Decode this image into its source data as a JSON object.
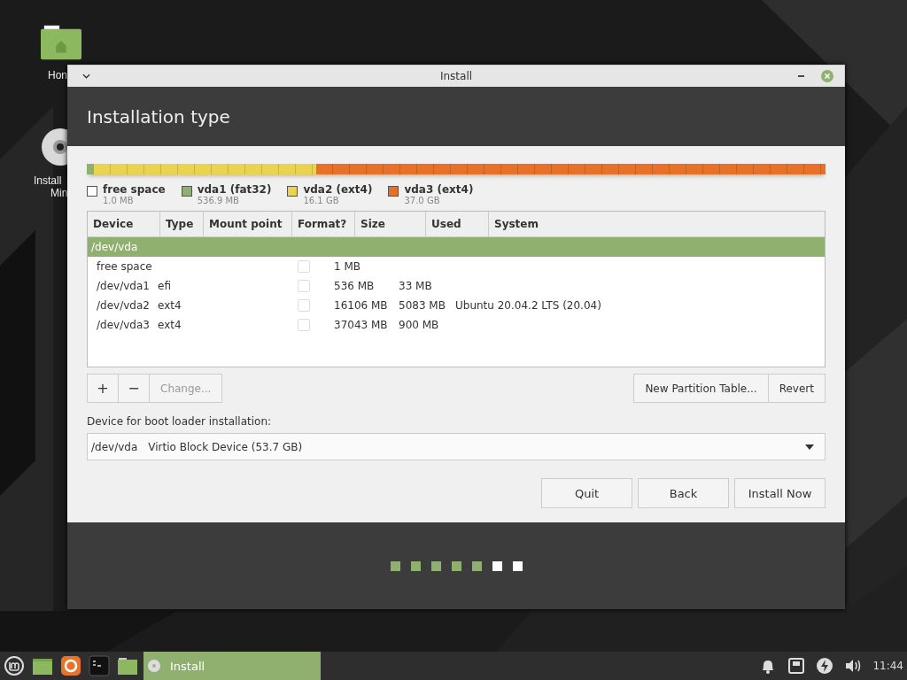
{
  "desktop_icons": [
    {
      "label": "Hon",
      "kind": "folder"
    },
    {
      "label": "Install",
      "label_2": "Min",
      "kind": "disc"
    }
  ],
  "window": {
    "title": "Install",
    "heading": "Installation type"
  },
  "partition_bar": [
    {
      "name": "free space",
      "size": "1.0 MB",
      "color": "#ffffff"
    },
    {
      "name": "vda1 (fat32)",
      "size": "536.9 MB",
      "color": "#8fb06f"
    },
    {
      "name": "vda2 (ext4)",
      "size": "16.1 GB",
      "color": "#e9d34f"
    },
    {
      "name": "vda3 (ext4)",
      "size": "37.0 GB",
      "color": "#e8712a"
    }
  ],
  "table": {
    "columns": [
      "Device",
      "Type",
      "Mount point",
      "Format?",
      "Size",
      "Used",
      "System"
    ],
    "rows": [
      {
        "kind": "disk",
        "device": "/dev/vda",
        "selected": true
      },
      {
        "kind": "partition",
        "device": "free space",
        "type": "",
        "mount": "",
        "format": false,
        "size": "1 MB",
        "used": "",
        "system": "",
        "selected": false
      },
      {
        "kind": "partition",
        "device": "/dev/vda1",
        "type": "efi",
        "mount": "",
        "format": false,
        "size": "536 MB",
        "used": "33 MB",
        "system": "",
        "selected": false
      },
      {
        "kind": "partition",
        "device": "/dev/vda2",
        "type": "ext4",
        "mount": "",
        "format": false,
        "size": "16106 MB",
        "used": "5083 MB",
        "system": "Ubuntu 20.04.2 LTS (20.04)",
        "selected": false
      },
      {
        "kind": "partition",
        "device": "/dev/vda3",
        "type": "ext4",
        "mount": "",
        "format": false,
        "size": "37043 MB",
        "used": "900 MB",
        "system": "",
        "selected": false
      }
    ]
  },
  "table_buttons": {
    "add": "+",
    "remove": "−",
    "change": "Change...",
    "new_table": "New Partition Table...",
    "revert": "Revert"
  },
  "boot_loader": {
    "label": "Device for boot loader installation:",
    "device": "/dev/vda",
    "description": "Virtio Block Device (53.7 GB)"
  },
  "buttons": [
    "Quit",
    "Back",
    "Install Now"
  ],
  "progress_steps": [
    {
      "done": true
    },
    {
      "done": true
    },
    {
      "done": true
    },
    {
      "done": true
    },
    {
      "done": true
    },
    {
      "done": false
    },
    {
      "done": false
    }
  ],
  "taskbar": {
    "window_button": {
      "label": "Install",
      "selected": true
    },
    "clock": "11:44"
  }
}
